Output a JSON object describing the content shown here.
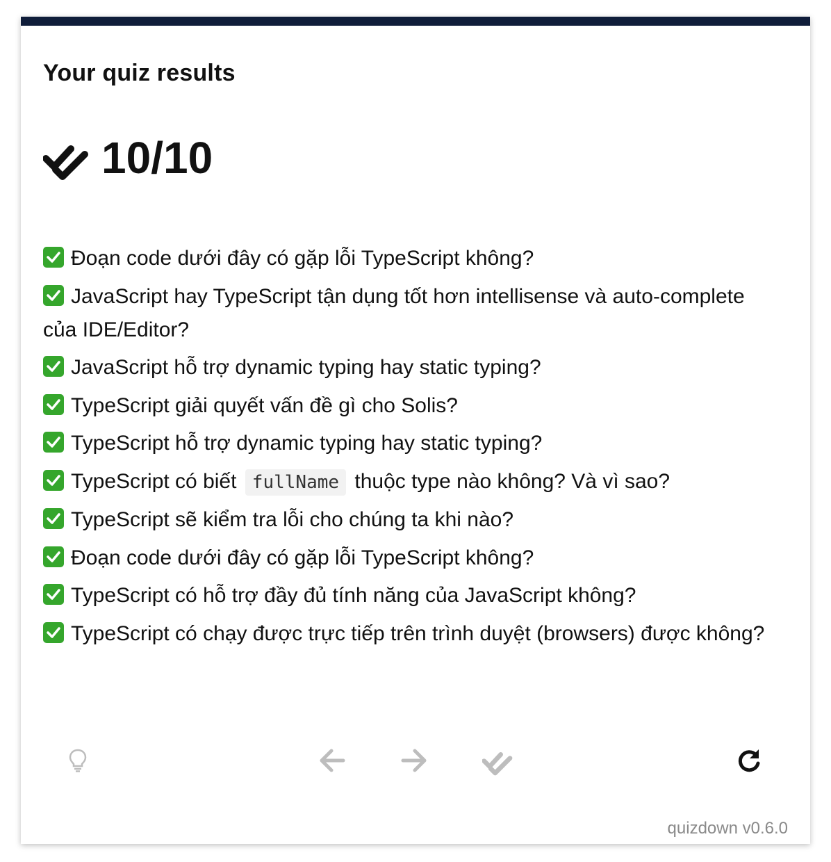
{
  "quiz": {
    "title": "Your quiz results",
    "score": "10/10",
    "results": [
      {
        "status": "correct",
        "pre": "Đoạn code dưới đây có gặp lỗi TypeScript không?"
      },
      {
        "status": "correct",
        "pre": "JavaScript hay TypeScript tận dụng tốt hơn intellisense và auto-complete của IDE/Editor?"
      },
      {
        "status": "correct",
        "pre": "JavaScript hỗ trợ dynamic typing hay static typing?"
      },
      {
        "status": "correct",
        "pre": "TypeScript giải quyết vấn đề gì cho Solis?"
      },
      {
        "status": "correct",
        "pre": "TypeScript hỗ trợ dynamic typing hay static typing?"
      },
      {
        "status": "correct",
        "pre": "TypeScript có biết",
        "code": "fullName",
        "post": "thuộc type nào không? Và vì sao?"
      },
      {
        "status": "correct",
        "pre": "TypeScript sẽ kiểm tra lỗi cho chúng ta khi nào?"
      },
      {
        "status": "correct",
        "pre": "Đoạn code dưới đây có gặp lỗi TypeScript không?"
      },
      {
        "status": "correct",
        "pre": "TypeScript có hỗ trợ đầy đủ tính năng của JavaScript không?"
      },
      {
        "status": "correct",
        "pre": "TypeScript có chạy được trực tiếp trên trình duyệt (browsers) được không?"
      }
    ]
  },
  "controls": {
    "hint_icon": "lightbulb-icon",
    "prev_icon": "arrow-left-icon",
    "next_icon": "arrow-right-icon",
    "submit_icon": "double-check-icon",
    "restart_icon": "restart-icon",
    "active_color": "#111111",
    "disabled_color": "#bdbdbd"
  },
  "footer": {
    "version": "quizdown v0.6.0"
  }
}
